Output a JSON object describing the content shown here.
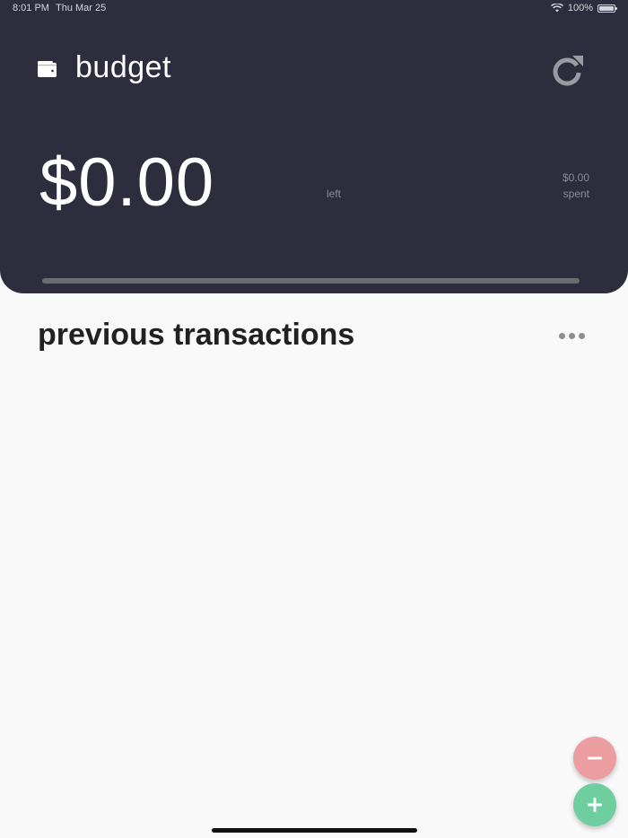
{
  "status_bar": {
    "time": "8:01 PM",
    "date": "Thu Mar 25",
    "battery": "100%"
  },
  "header": {
    "title": "budget",
    "icons": {
      "wallet": "wallet-icon",
      "refresh": "refresh-icon"
    },
    "amount_left": "$0.00",
    "left_label": "left",
    "spent_amount": "$0.00",
    "spent_label": "spent",
    "progress_fraction": 0.0
  },
  "transactions": {
    "title": "previous transactions",
    "more_icon": "more-dots-icon",
    "items": []
  },
  "actions": {
    "subtract_icon": "minus-icon",
    "add_icon": "plus-icon"
  },
  "colors": {
    "header_bg": "#2e2d3d",
    "body_bg": "#f9f9f9",
    "subtract": "#ec9da0",
    "add": "#6fcea0"
  }
}
